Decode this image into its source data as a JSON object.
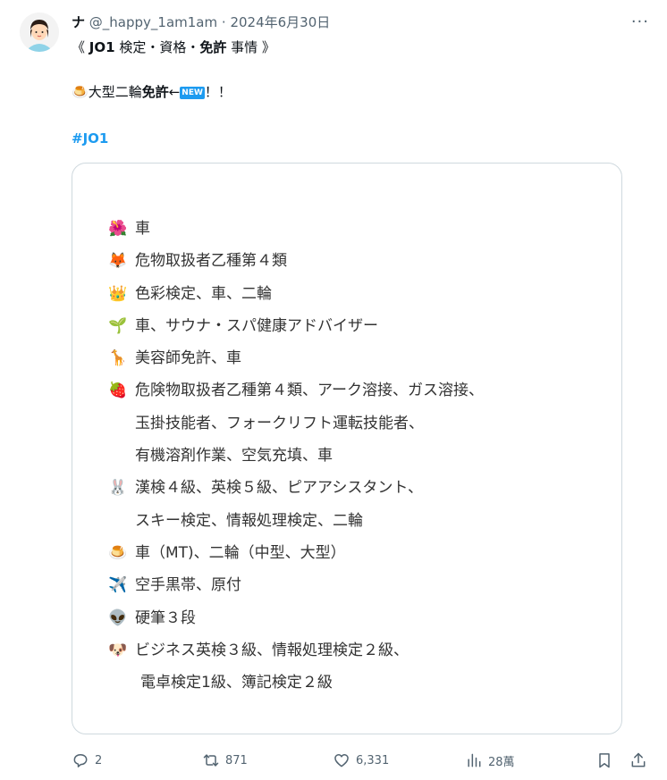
{
  "tweet": {
    "name": "ナ",
    "handle": "@_happy_1am1am",
    "separator": "·",
    "date": "2024年6月30日",
    "more_label": "···",
    "line1_prefix": "《 ",
    "line1_jo1": "JO1",
    "line1_mid": " 検定・資格・",
    "line1_bold": "免許",
    "line1_suffix": " 事情 》",
    "line2_emoji": "🍮",
    "line2_text": "大型二輪",
    "line2_bold": "免許",
    "line2_arrow": "←",
    "line2_badge": "NEW",
    "line2_end": "！！",
    "hashtag": "#JO1"
  },
  "card_lines": [
    {
      "emoji": "🌺",
      "text": "車"
    },
    {
      "emoji": "🦊",
      "text": "危物取扱者乙種第４類"
    },
    {
      "emoji": "👑",
      "text": "色彩検定、車、二輪"
    },
    {
      "emoji": "🌱",
      "text": "車、サウナ・スパ健康アドバイザー"
    },
    {
      "emoji": "🦒",
      "text": "美容師免許、車"
    },
    {
      "emoji": "🍓",
      "text": "危険物取扱者乙種第４類、アーク溶接、ガス溶接、"
    },
    {
      "emoji": "",
      "text": "玉掛技能者、フォークリフト運転技能者、"
    },
    {
      "emoji": "",
      "text": "有機溶剤作業、空気充填、車"
    },
    {
      "emoji": "🐰",
      "text": "漢検４級、英検５級、ピアアシスタント、"
    },
    {
      "emoji": "",
      "text": "スキー検定、情報処理検定、二輪"
    },
    {
      "emoji": "🍮",
      "text": "車（MT)、二輪（中型、大型）"
    },
    {
      "emoji": "✈️",
      "text": "空手黒帯、原付"
    },
    {
      "emoji": "👽",
      "text": "硬筆３段"
    },
    {
      "emoji": "🐶",
      "text": "ビジネス英検３級、情報処理検定２級、"
    },
    {
      "emoji": "",
      "text": "電卓検定1級、簿記検定２級"
    }
  ],
  "actions": {
    "replies": "2",
    "reposts": "871",
    "likes": "6,331",
    "views": "28萬"
  },
  "icons": {
    "reply": "speech-bubble-icon",
    "repost": "repost-arrows-icon",
    "like": "heart-icon",
    "views": "bar-chart-icon",
    "bookmark": "bookmark-icon",
    "share": "share-upload-icon"
  },
  "colors": {
    "accent": "#1d9bf0",
    "text": "#0f1419",
    "muted": "#536471",
    "border": "#cfd9de"
  }
}
